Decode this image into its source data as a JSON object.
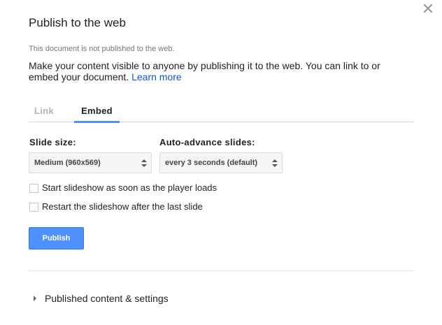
{
  "dialog": {
    "title": "Publish to the web",
    "status": "This document is not published to the web.",
    "description": "Make your content visible to anyone by publishing it to the web. You can link to or embed your document.",
    "learn_more": "Learn more",
    "close_icon": "close-icon"
  },
  "tabs": [
    {
      "label": "Link",
      "selected": false
    },
    {
      "label": "Embed",
      "selected": true
    }
  ],
  "embed": {
    "slide_size": {
      "label": "Slide size:",
      "value": "Medium (960x569)"
    },
    "auto_advance": {
      "label": "Auto-advance slides:",
      "value": "every 3 seconds (default)"
    },
    "options": [
      {
        "label": "Start slideshow as soon as the player loads",
        "checked": false
      },
      {
        "label": "Restart the slideshow after the last slide",
        "checked": false
      }
    ],
    "publish_label": "Publish"
  },
  "published_section": {
    "label": "Published content & settings",
    "expanded": false
  },
  "colors": {
    "accent": "#4d90fe",
    "link": "#1155cc",
    "tab_inactive": "#b4b4b4"
  }
}
